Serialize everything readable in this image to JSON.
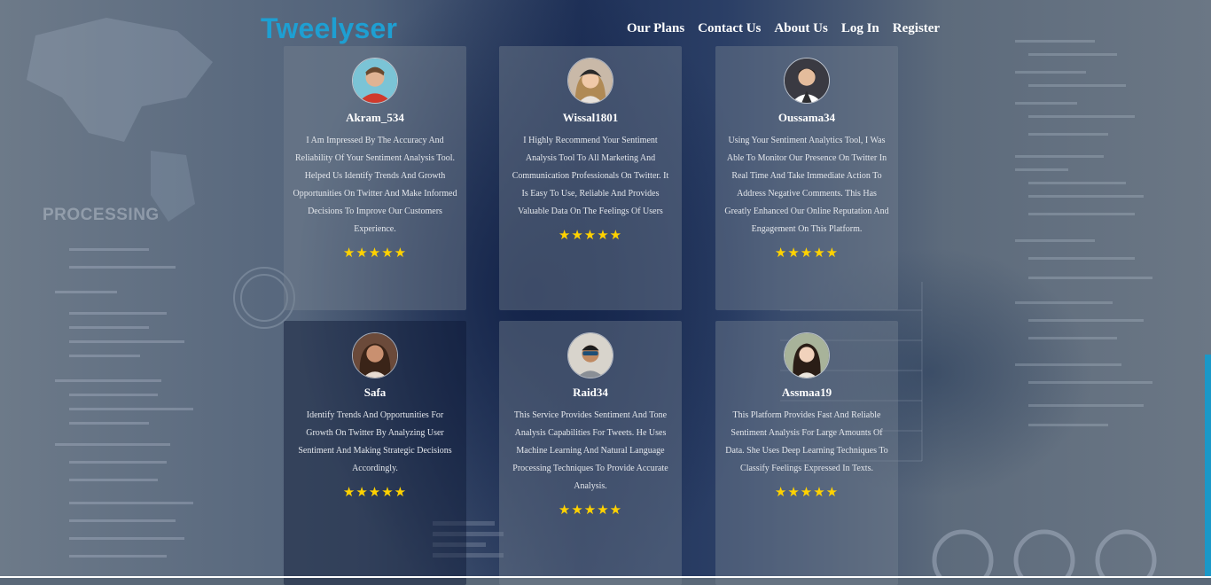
{
  "brand": {
    "logo": "Tweelyser",
    "accent": "#1e9fd2"
  },
  "nav": {
    "items": [
      "Our Plans",
      "Contact Us",
      "About Us",
      "Log In",
      "Register"
    ]
  },
  "background": {
    "caption": "PROCESSING"
  },
  "testimonials": [
    {
      "name": "Akram_534",
      "text": "I Am Impressed By The Accuracy And Reliability Of Your Sentiment Analysis Tool. Helped Us Identify Trends And Growth Opportunities On Twitter And Make Informed Decisions To Improve Our Customers Experience.",
      "stars": "★★★★★",
      "rating": 5
    },
    {
      "name": "Wissal1801",
      "text": "I Highly Recommend Your Sentiment Analysis Tool To All Marketing And Communication Professionals On Twitter. It Is Easy To Use, Reliable And Provides Valuable Data On The Feelings Of Users",
      "stars": "★★★★★",
      "rating": 5
    },
    {
      "name": "Oussama34",
      "text": "Using Your Sentiment Analytics Tool, I Was Able To Monitor Our Presence On Twitter In Real Time And Take Immediate Action To Address Negative Comments. This Has Greatly Enhanced Our Online Reputation And Engagement On This Platform.",
      "stars": "★★★★★",
      "rating": 5
    },
    {
      "name": "Safa",
      "text": "Identify Trends And Opportunities For Growth On Twitter By Analyzing User Sentiment And Making Strategic Decisions Accordingly.",
      "stars": "★★★★★",
      "rating": 5
    },
    {
      "name": "Raid34",
      "text": "This Service Provides Sentiment And Tone Analysis Capabilities For Tweets. He Uses Machine Learning And Natural Language Processing Techniques To Provide Accurate Analysis.",
      "stars": "★★★★★",
      "rating": 5
    },
    {
      "name": "Assmaa19",
      "text": "This Platform Provides Fast And Reliable Sentiment Analysis For Large Amounts Of Data. She Uses Deep Learning Techniques To Classify Feelings Expressed In Texts.",
      "stars": "★★★★★",
      "rating": 5
    }
  ]
}
